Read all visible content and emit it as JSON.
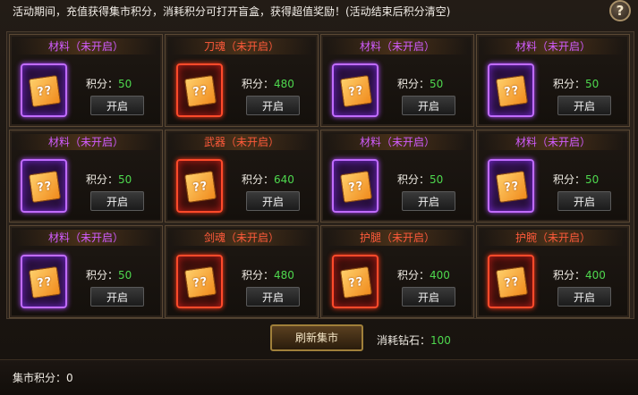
{
  "notice": "活动期间，充值获得集市积分，消耗积分可打开盲盒，获得超值奖励！(活动结束后积分清空)",
  "help_label": "?",
  "cards": [
    {
      "title": "材料（未开启）",
      "score_label": "积分：",
      "score": "50",
      "button": "开启",
      "cube": "??",
      "color": "purple"
    },
    {
      "title": "刀魂（未开启）",
      "score_label": "积分：",
      "score": "480",
      "button": "开启",
      "cube": "??",
      "color": "red"
    },
    {
      "title": "材料（未开启）",
      "score_label": "积分：",
      "score": "50",
      "button": "开启",
      "cube": "??",
      "color": "purple"
    },
    {
      "title": "材料（未开启）",
      "score_label": "积分：",
      "score": "50",
      "button": "开启",
      "cube": "??",
      "color": "purple"
    },
    {
      "title": "材料（未开启）",
      "score_label": "积分：",
      "score": "50",
      "button": "开启",
      "cube": "??",
      "color": "purple"
    },
    {
      "title": "武器（未开启）",
      "score_label": "积分：",
      "score": "640",
      "button": "开启",
      "cube": "??",
      "color": "red"
    },
    {
      "title": "材料（未开启）",
      "score_label": "积分：",
      "score": "50",
      "button": "开启",
      "cube": "??",
      "color": "purple"
    },
    {
      "title": "材料（未开启）",
      "score_label": "积分：",
      "score": "50",
      "button": "开启",
      "cube": "??",
      "color": "purple"
    },
    {
      "title": "材料（未开启）",
      "score_label": "积分：",
      "score": "50",
      "button": "开启",
      "cube": "??",
      "color": "purple"
    },
    {
      "title": "剑魂（未开启）",
      "score_label": "积分：",
      "score": "480",
      "button": "开启",
      "cube": "??",
      "color": "red"
    },
    {
      "title": "护腿（未开启）",
      "score_label": "积分：",
      "score": "400",
      "button": "开启",
      "cube": "??",
      "color": "red"
    },
    {
      "title": "护腕（未开启）",
      "score_label": "积分：",
      "score": "400",
      "button": "开启",
      "cube": "??",
      "color": "red"
    }
  ],
  "refresh_button": "刷新集市",
  "cost_label": "消耗钻石：",
  "cost_value": "100",
  "market_score_label": "集市积分：0",
  "colors": {
    "purple": "#c06bff",
    "red": "#ff4a2a",
    "value_green": "#4ed84e"
  }
}
